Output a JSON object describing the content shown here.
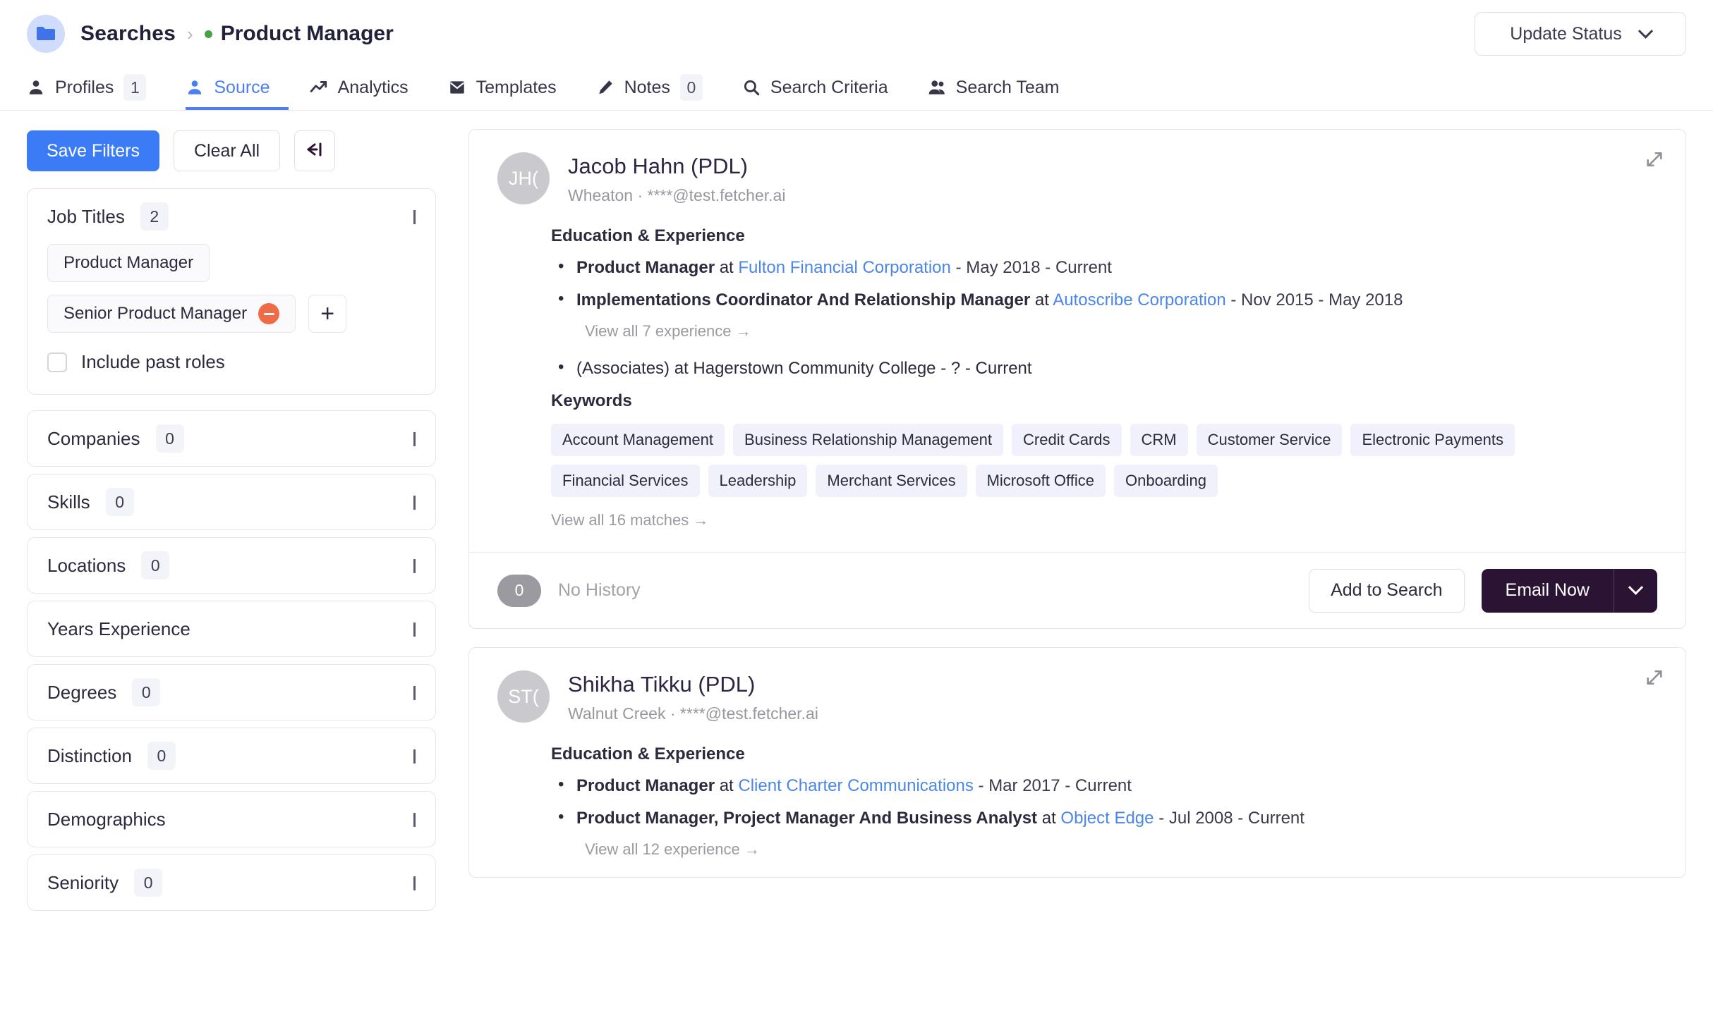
{
  "header": {
    "folder_icon": "folder-icon",
    "breadcrumb_root": "Searches",
    "breadcrumb_separator": "›",
    "breadcrumb_current": "Product Manager",
    "status_dot_color": "#48a148",
    "update_status_label": "Update Status"
  },
  "tabs": [
    {
      "label": "Profiles",
      "icon": "person-icon",
      "badge": "1",
      "active": false
    },
    {
      "label": "Source",
      "icon": "person-icon",
      "badge": null,
      "active": true
    },
    {
      "label": "Analytics",
      "icon": "trend-up-icon",
      "badge": null,
      "active": false
    },
    {
      "label": "Templates",
      "icon": "envelope-icon",
      "badge": null,
      "active": false
    },
    {
      "label": "Notes",
      "icon": "pencil-icon",
      "badge": "0",
      "active": false
    },
    {
      "label": "Search Criteria",
      "icon": "search-icon",
      "badge": null,
      "active": false
    },
    {
      "label": "Search Team",
      "icon": "people-icon",
      "badge": null,
      "active": false
    }
  ],
  "sidebar": {
    "save_filters_label": "Save Filters",
    "clear_all_label": "Clear All",
    "collapse_icon": "collapse-left-icon",
    "job_titles": {
      "title": "Job Titles",
      "count": "2",
      "expanded": true,
      "chips": [
        {
          "label": "Product Manager",
          "removable": false
        },
        {
          "label": "Senior Product Manager",
          "removable": true
        }
      ],
      "add_label": "+",
      "include_past_roles_label": "Include past roles",
      "include_past_roles_checked": false
    },
    "sections": [
      {
        "title": "Companies",
        "count": "0"
      },
      {
        "title": "Skills",
        "count": "0"
      },
      {
        "title": "Locations",
        "count": "0"
      },
      {
        "title": "Years Experience",
        "count": null
      },
      {
        "title": "Degrees",
        "count": "0"
      },
      {
        "title": "Distinction",
        "count": "0"
      },
      {
        "title": "Demographics",
        "count": null
      },
      {
        "title": "Seniority",
        "count": "0"
      }
    ]
  },
  "candidates": [
    {
      "initials": "JH(",
      "name": "Jacob Hahn (PDL)",
      "subtitle": "Wheaton · ****@test.fetcher.ai",
      "section_title": "Education & Experience",
      "experience": [
        {
          "role": "Product Manager",
          "at": "at",
          "company": "Fulton Financial Corporation",
          "dates": "- May 2018 - Current"
        },
        {
          "role": "Implementations Coordinator And Relationship Manager",
          "at": "at",
          "company": "Autoscribe Corporation",
          "dates": "- Nov 2015 - May 2018"
        }
      ],
      "view_all_experience": "View all 7 experience →",
      "education": [
        {
          "text": "(Associates) at Hagerstown Community College - ? - Current"
        }
      ],
      "keywords_title": "Keywords",
      "keywords": [
        "Account Management",
        "Business Relationship Management",
        "Credit Cards",
        "CRM",
        "Customer Service",
        "Electronic Payments",
        "Financial Services",
        "Leadership",
        "Merchant Services",
        "Microsoft Office",
        "Onboarding"
      ],
      "view_all_matches": "View all 16 matches →",
      "history_count": "0",
      "history_text": "No History",
      "add_to_search_label": "Add to Search",
      "email_now_label": "Email Now",
      "expand_icon": "expand-diagonal-icon",
      "has_footer": true
    },
    {
      "initials": "ST(",
      "name": "Shikha Tikku (PDL)",
      "subtitle": "Walnut Creek · ****@test.fetcher.ai",
      "section_title": "Education & Experience",
      "experience": [
        {
          "role": "Product Manager",
          "at": "at",
          "company": "Client Charter Communications",
          "dates": "- Mar 2017 - Current"
        },
        {
          "role": "Product Manager, Project Manager And Business Analyst",
          "at": "at",
          "company": "Object Edge",
          "dates": "- Jul 2008 - Current"
        }
      ],
      "view_all_experience": "View all 12 experience →",
      "education": [],
      "keywords_title": null,
      "keywords": [],
      "view_all_matches": null,
      "history_count": null,
      "history_text": null,
      "add_to_search_label": null,
      "email_now_label": null,
      "expand_icon": "expand-diagonal-icon",
      "has_footer": false
    }
  ],
  "colors": {
    "accent_blue": "#3b7cf6",
    "link_blue": "#4b86e8",
    "dark_purple": "#2b1333",
    "chip_remove_orange": "#ef6b45",
    "keyword_bg": "#f1f1fb",
    "status_green": "#48a148"
  }
}
